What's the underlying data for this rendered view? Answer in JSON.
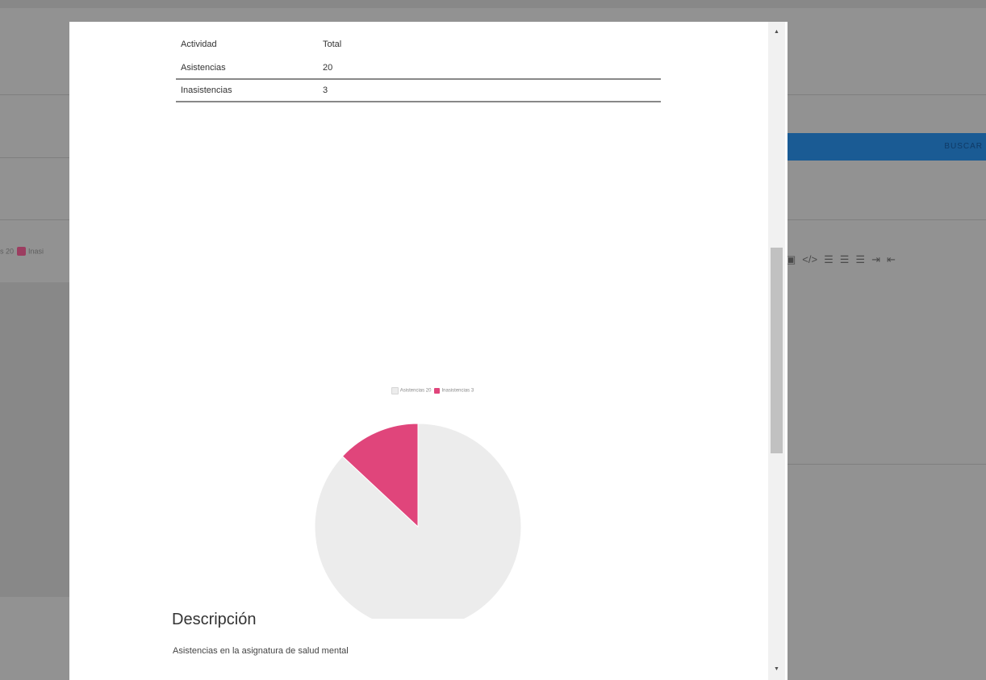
{
  "background": {
    "legend_value_text": "s 20",
    "legend_second_label": "Inasi",
    "search_button_label": "BUSCAR",
    "toolbar_icons": [
      "image-icon",
      "code-icon",
      "align-left-icon",
      "align-center-icon",
      "align-right-icon",
      "indent-icon",
      "outdent-icon"
    ]
  },
  "modal": {
    "table": {
      "headers": [
        "Actividad",
        "Total"
      ],
      "rows": [
        {
          "actividad": "Asistencias",
          "total": "20"
        },
        {
          "actividad": "Inasistencias",
          "total": "3"
        }
      ]
    },
    "description": {
      "title": "Descripción",
      "text": "Asistencias en la asignatura de salud mental"
    }
  },
  "chart_data": {
    "type": "pie",
    "categories": [
      "Asistencias",
      "Inasistencias"
    ],
    "values": [
      20,
      3
    ],
    "legend": [
      "Asistencias 20",
      "Inasistencias 3"
    ],
    "colors": [
      "#ececec",
      "#e0457b"
    ],
    "legend_position": "top"
  }
}
